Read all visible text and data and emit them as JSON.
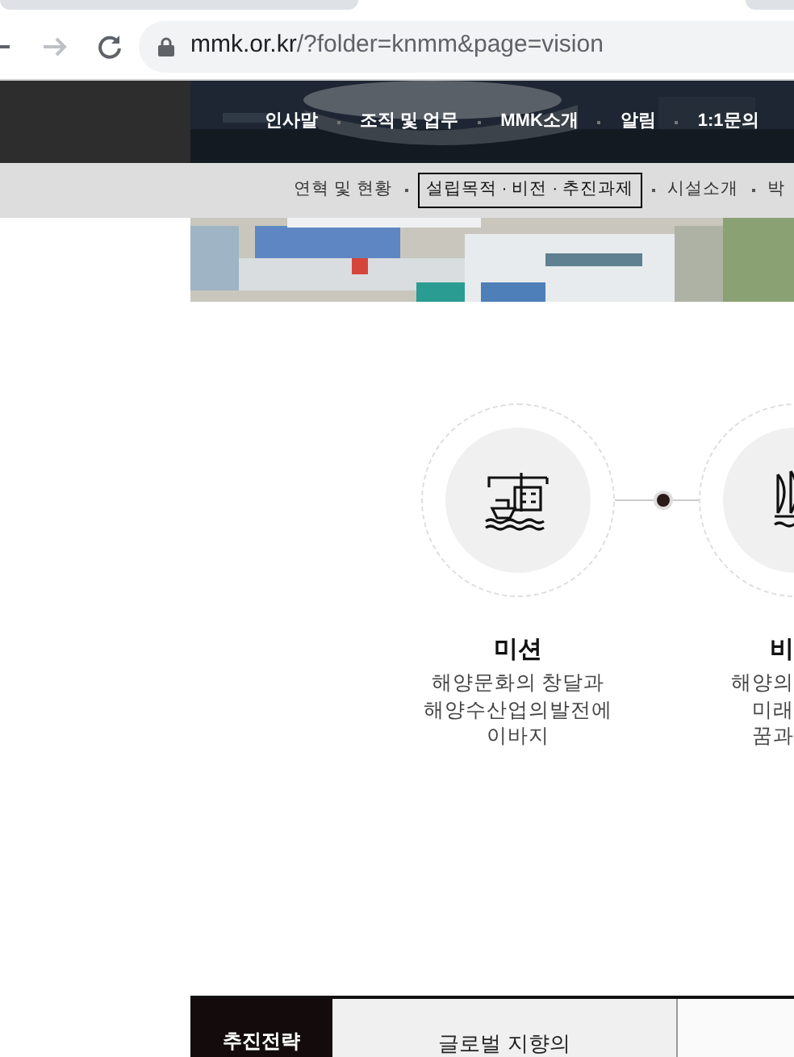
{
  "browser": {
    "url_host": "mmk.or.kr",
    "url_path": "/?folder=knmm&page=vision"
  },
  "main_nav": [
    {
      "label": "인사말"
    },
    {
      "label": "조직 및 업무"
    },
    {
      "label": "MMK소개"
    },
    {
      "label": "알림"
    },
    {
      "label": "1:1문의"
    }
  ],
  "sub_nav": [
    {
      "label": "연혁 및 현황",
      "selected": false
    },
    {
      "label": "설립목적 · 비전 · 추진과제",
      "selected": true
    },
    {
      "label": "시설소개",
      "selected": false
    },
    {
      "label": "박",
      "selected": false
    }
  ],
  "values": [
    {
      "kind": "port",
      "title": "미션",
      "lines": [
        "해양문화의 창달과",
        "해양수산업의발전에",
        "이바지"
      ]
    },
    {
      "kind": "ship",
      "title": "비",
      "lines": [
        "해양의",
        "미래",
        "꿈과"
      ]
    }
  ],
  "table": {
    "header": "추진전략",
    "cells": [
      "글로벌 지향의"
    ]
  }
}
